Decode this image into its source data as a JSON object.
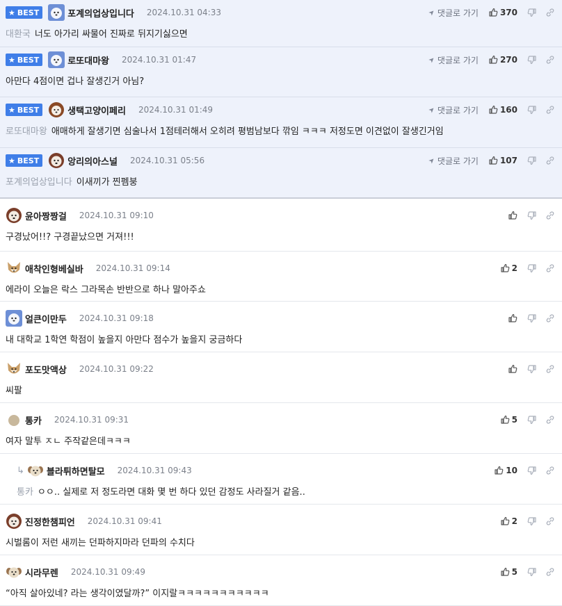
{
  "best_label": "BEST",
  "goto_label": "댓글로 가기",
  "comments": [
    {
      "kind": "best",
      "nick": "포계의업상입니다",
      "time": "2024.10.31 04:33",
      "mention": "대환국",
      "text": "너도 아가리 싸물어 진짜로 뒤지기싫으면",
      "likes": "370",
      "avatar": "snow"
    },
    {
      "kind": "best",
      "nick": "로또대마왕",
      "time": "2024.10.31 01:47",
      "mention": "",
      "text": "아만다 4점이면 겁나 잘생긴거 아님?",
      "likes": "270",
      "avatar": "snow"
    },
    {
      "kind": "best",
      "nick": "생택고양이페리",
      "time": "2024.10.31 01:49",
      "mention": "로또대마왕",
      "text": "애매하게 잘생기면 심술나서 1점테러해서 오히려 평범남보다 깎임 ㅋㅋㅋ 저정도면 이견없이 잘생긴거임",
      "likes": "160",
      "avatar": "lion"
    },
    {
      "kind": "best",
      "nick": "앙리의아스널",
      "time": "2024.10.31 05:56",
      "mention": "포계의업상입니다",
      "text": "이새끼가 찐펨붕",
      "likes": "107",
      "avatar": "dog"
    },
    {
      "kind": "normal",
      "nick": "윤아짱짱걸",
      "time": "2024.10.31 09:10",
      "mention": "",
      "text": "구경났어!!? 구경끝났으면 거져!!!",
      "likes": "",
      "avatar": "dog"
    },
    {
      "kind": "normal",
      "nick": "애착인형베실바",
      "time": "2024.10.31 09:14",
      "mention": "",
      "text": "에라이 오늘은 락스 그라목손 반반으로 하나 말아주쇼",
      "likes": "2",
      "avatar": "fox"
    },
    {
      "kind": "normal",
      "nick": "얼큰이만두",
      "time": "2024.10.31 09:18",
      "mention": "",
      "text": "내 대학교 1학연 학점이 높을지 아만다 점수가 높을지 궁금하다",
      "likes": "",
      "avatar": "snow"
    },
    {
      "kind": "normal",
      "nick": "포도맛액상",
      "time": "2024.10.31 09:22",
      "mention": "",
      "text": "씨팔",
      "likes": "",
      "avatar": "fox"
    },
    {
      "kind": "normal",
      "nick": "통카",
      "time": "2024.10.31 09:31",
      "mention": "",
      "text": "여자 말투 ㅈㄴ 주작같은데ㅋㅋㅋ",
      "likes": "5",
      "avatar": "circle"
    },
    {
      "kind": "reply",
      "nick": "블라튀하면탈모",
      "time": "2024.10.31 09:43",
      "mention": "통카",
      "text": "ㅇㅇ.. 실제로 저 정도라면 대화 몇 번 하다 있던 감정도 사라질거 같음..",
      "likes": "10",
      "avatar": "pup"
    },
    {
      "kind": "normal",
      "nick": "진정한챔피언",
      "time": "2024.10.31 09:41",
      "mention": "",
      "text": "시벌롬이 저런 새끼는 던파하지마라 던파의 수치다",
      "likes": "2",
      "avatar": "dog"
    },
    {
      "kind": "normal",
      "nick": "시라무렌",
      "time": "2024.10.31 09:49",
      "mention": "",
      "text": "“아직 살아있네? 라는 생각이였달까?” 이지랄ㅋㅋㅋㅋㅋㅋㅋㅋㅋㅋㅋ",
      "likes": "5",
      "avatar": "pup"
    }
  ]
}
